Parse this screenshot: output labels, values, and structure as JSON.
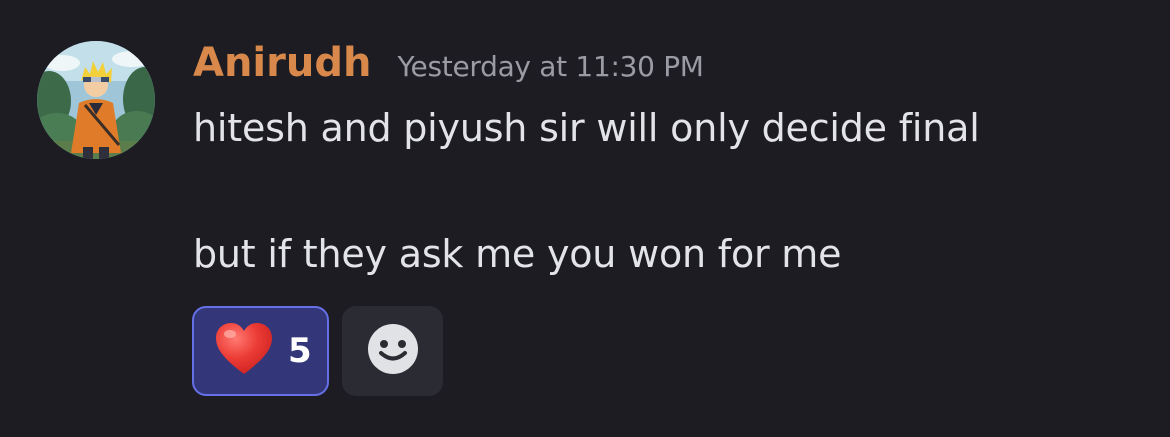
{
  "message": {
    "author": "Anirudh",
    "timestamp": "Yesterday at 11:30 PM",
    "lines": [
      "hitesh and piyush sir will only decide final",
      "but if they ask me you won for me"
    ]
  },
  "reactions": [
    {
      "emoji_icon": "red-heart-icon",
      "count": "5",
      "selected": true
    }
  ],
  "add_reaction": {
    "icon": "smiley-face-icon"
  },
  "colors": {
    "background": "#1c1c22",
    "author_name": "#d8884a",
    "timestamp": "#9a9ba3",
    "message_text": "#e3e4e8",
    "reaction_selected_bg": "#333779",
    "reaction_selected_border": "#6670e6"
  }
}
